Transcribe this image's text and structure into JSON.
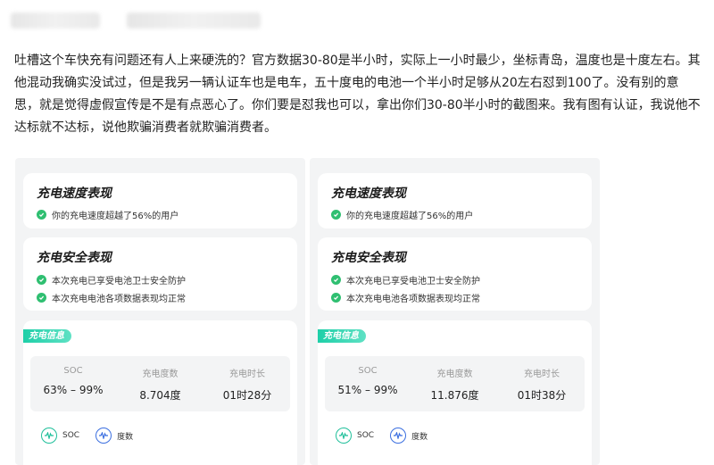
{
  "post": {
    "text": "吐槽这个车快充有问题还有人上来硬洗的？官方数据30-80是半小时，实际上一小时最少，坐标青岛，温度也是十度左右。其他混动我确实没试过，但是我另一辆认证车也是电车，五十度电的电池一个半小时足够从20左右怼到100了。没有别的意思，就是觉得虚假宣传是不是有点恶心了。你们要是怼我也可以，拿出你们30-80半小时的截图来。我有图有认证，我说他不达标就不达标，说他欺骗消费者就欺骗消费者。"
  },
  "screenshots": [
    {
      "speed_title": "充电速度表现",
      "speed_item": "你的充电速度超越了56%的用户",
      "safety_title": "充电安全表现",
      "safety_items": [
        "本次充电已享受电池卫士安全防护",
        "本次充电电池各项数据表现均正常"
      ],
      "info_tag": "充电信息",
      "stats": [
        {
          "label": "SOC",
          "value": "63% – 99%"
        },
        {
          "label": "充电度数",
          "value": "8.704度"
        },
        {
          "label": "充电时长",
          "value": "01时28分"
        }
      ],
      "legend": [
        "SOC",
        "度数"
      ]
    },
    {
      "speed_title": "充电速度表现",
      "speed_item": "你的充电速度超越了56%的用户",
      "safety_title": "充电安全表现",
      "safety_items": [
        "本次充电已享受电池卫士安全防护",
        "本次充电电池各项数据表现均正常"
      ],
      "info_tag": "充电信息",
      "stats": [
        {
          "label": "SOC",
          "value": "51% – 99%"
        },
        {
          "label": "充电度数",
          "value": "11.876度"
        },
        {
          "label": "充电时长",
          "value": "01时38分"
        }
      ],
      "legend": [
        "SOC",
        "度数"
      ]
    }
  ],
  "colors": {
    "check_green": "#2fbf71",
    "tag_teal": "#1ecfa8",
    "soc_icon": "#1fbf9a",
    "kwh_icon": "#3b6fe0"
  }
}
